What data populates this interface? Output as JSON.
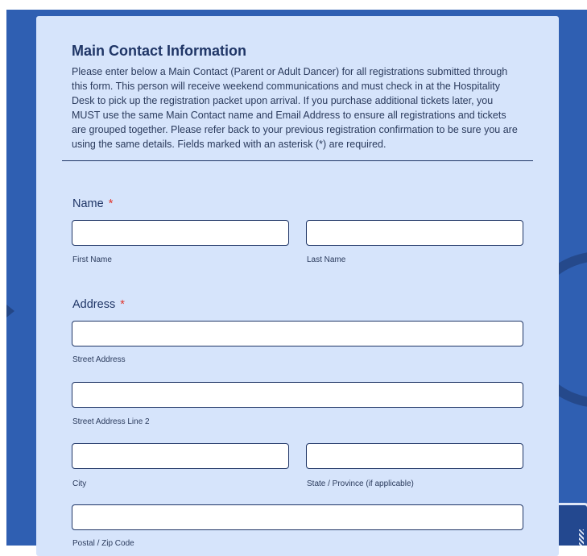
{
  "section": {
    "title": "Main Contact Information",
    "description": "Please enter below a Main Contact (Parent or Adult Dancer) for all registrations submitted through this form. This person will receive weekend communications and must check in at the Hospitality Desk to pick up the registration packet upon arrival. If you purchase additional tickets later, you MUST use the same Main Contact name and Email Address to ensure all registrations and tickets are grouped together. Please refer back to your previous registration confirmation to be sure you are using the same details. Fields marked with an asterisk (*) are required."
  },
  "name": {
    "label": "Name",
    "required_mark": "*",
    "first_sublabel": "First Name",
    "last_sublabel": "Last Name",
    "first_value": "",
    "last_value": ""
  },
  "address": {
    "label": "Address",
    "required_mark": "*",
    "street_sublabel": "Street Address",
    "street2_sublabel": "Street Address Line 2",
    "city_sublabel": "City",
    "state_sublabel": "State / Province (if applicable)",
    "postal_sublabel": "Postal / Zip Code"
  },
  "colors": {
    "background": "#2f5fb2",
    "card": "#d6e4fb",
    "text": "#1f3566",
    "required": "#e0342b"
  }
}
